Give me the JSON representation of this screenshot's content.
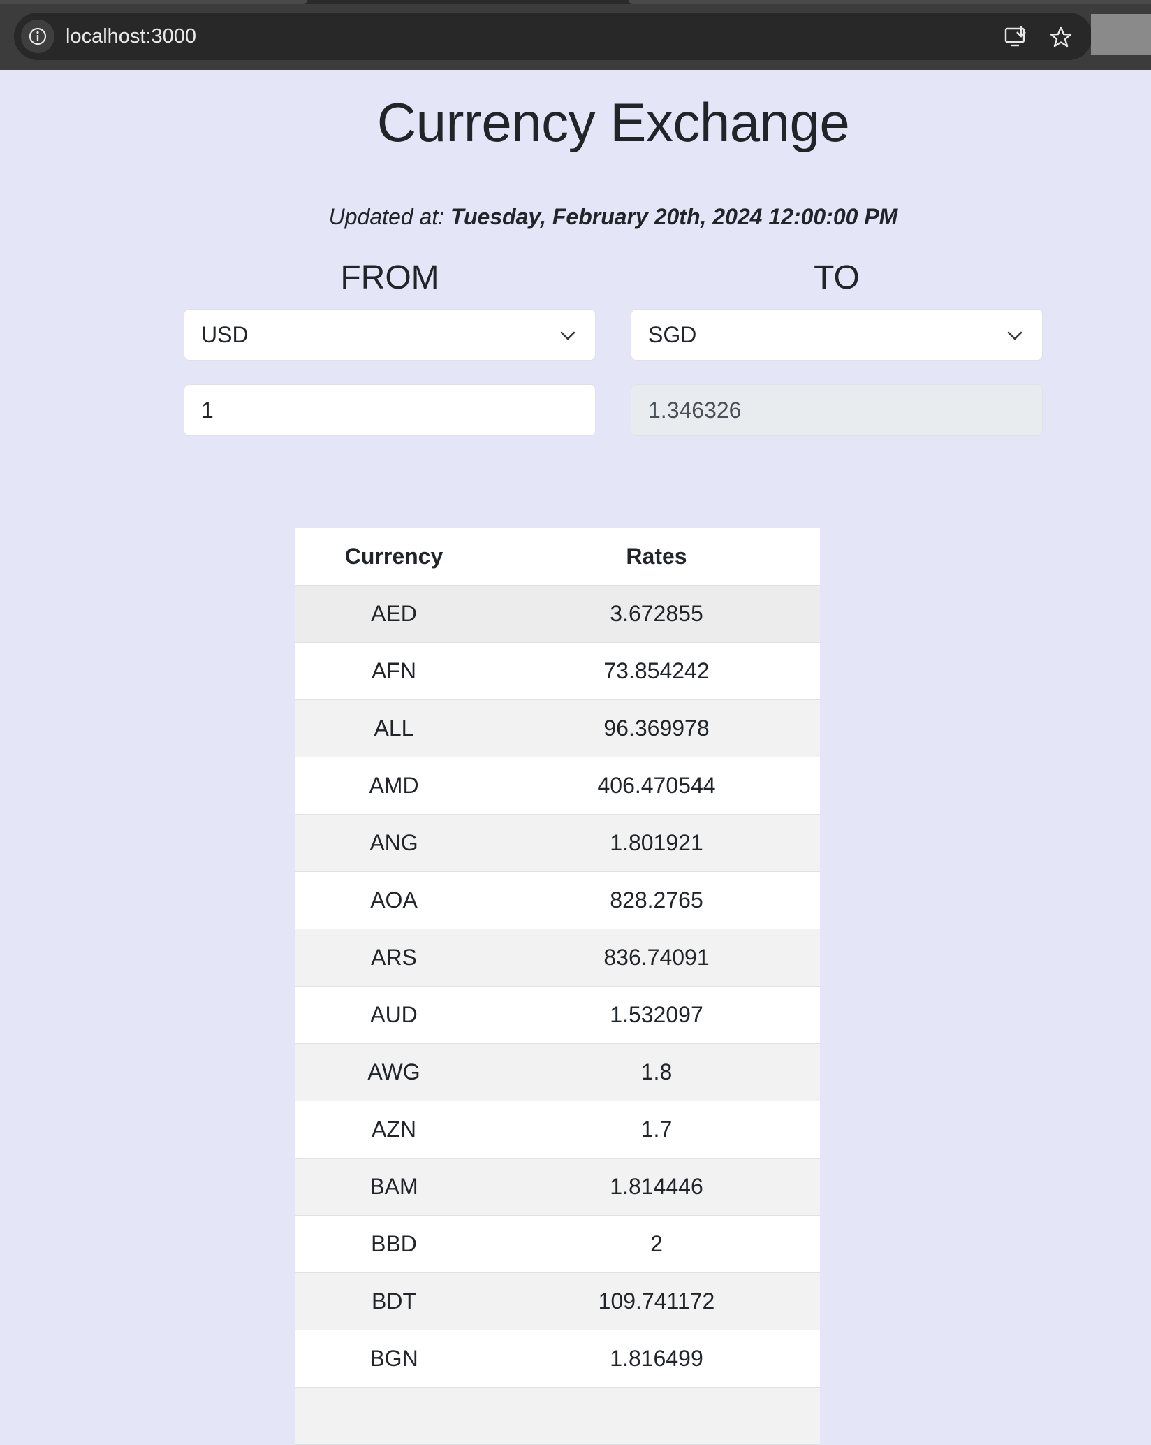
{
  "browser": {
    "url": "localhost:3000",
    "info_icon": "info-icon",
    "install_icon": "install-app-icon",
    "bookmark_icon": "star-icon"
  },
  "page": {
    "title": "Currency Exchange",
    "updated_prefix": "Updated at:",
    "updated_value": "Tuesday, February 20th, 2024 12:00:00 PM"
  },
  "converter": {
    "from_label": "FROM",
    "to_label": "TO",
    "from_currency": "USD",
    "to_currency": "SGD",
    "from_amount": "1",
    "to_amount": "1.346326"
  },
  "table": {
    "headers": [
      "Currency",
      "Rates"
    ],
    "rows": [
      {
        "currency": "AED",
        "rate": "3.672855"
      },
      {
        "currency": "AFN",
        "rate": "73.854242"
      },
      {
        "currency": "ALL",
        "rate": "96.369978"
      },
      {
        "currency": "AMD",
        "rate": "406.470544"
      },
      {
        "currency": "ANG",
        "rate": "1.801921"
      },
      {
        "currency": "AOA",
        "rate": "828.2765"
      },
      {
        "currency": "ARS",
        "rate": "836.74091"
      },
      {
        "currency": "AUD",
        "rate": "1.532097"
      },
      {
        "currency": "AWG",
        "rate": "1.8"
      },
      {
        "currency": "AZN",
        "rate": "1.7"
      },
      {
        "currency": "BAM",
        "rate": "1.814446"
      },
      {
        "currency": "BBD",
        "rate": "2"
      },
      {
        "currency": "BDT",
        "rate": "109.741172"
      },
      {
        "currency": "BGN",
        "rate": "1.816499"
      }
    ]
  },
  "colors": {
    "page_background": "#e5e5f8",
    "browser_chrome": "#3c3c3c",
    "text": "#212529"
  }
}
